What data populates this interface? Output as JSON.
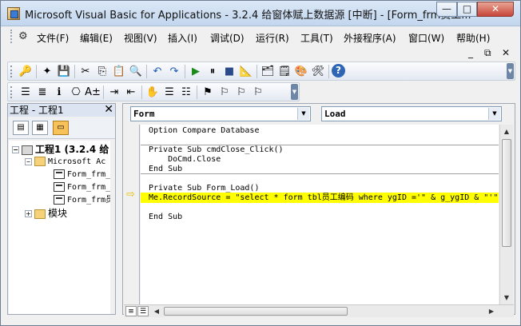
{
  "window": {
    "title": "Microsoft Visual Basic for Applications - 3.2.4 给窗体赋上数据源 [中断] - [Form_frm员工...",
    "controls": {
      "minimize": "—",
      "maximize": "□",
      "close": "✕"
    }
  },
  "menubar": {
    "items": [
      "文件(F)",
      "编辑(E)",
      "视图(V)",
      "插入(I)",
      "调试(D)",
      "运行(R)",
      "工具(T)",
      "外接程序(A)",
      "窗口(W)",
      "帮助(H)"
    ],
    "mdi_controls": {
      "minimize": "_",
      "restore": "⧉",
      "close": "✕"
    }
  },
  "toolbars": {
    "standard": [
      {
        "name": "access-view-icon",
        "glyph": "🔑"
      },
      {
        "name": "insert-module-icon",
        "glyph": "✦"
      },
      {
        "name": "save-icon",
        "glyph": "💾"
      },
      {
        "name": "cut-icon",
        "glyph": "✂"
      },
      {
        "name": "copy-icon",
        "glyph": "⎘"
      },
      {
        "name": "paste-icon",
        "glyph": "📋"
      },
      {
        "name": "find-icon",
        "glyph": "🔍"
      },
      {
        "name": "undo-icon",
        "glyph": "↶"
      },
      {
        "name": "redo-icon",
        "glyph": "↷"
      },
      {
        "name": "run-icon",
        "glyph": "▶"
      },
      {
        "name": "break-icon",
        "glyph": "⏸"
      },
      {
        "name": "reset-icon",
        "glyph": "■"
      },
      {
        "name": "design-mode-icon",
        "glyph": "📐"
      },
      {
        "name": "project-explorer-icon",
        "glyph": "🗂"
      },
      {
        "name": "properties-icon",
        "glyph": "🗒"
      },
      {
        "name": "object-browser-icon",
        "glyph": "🎨"
      },
      {
        "name": "toolbox-icon",
        "glyph": "🛠"
      },
      {
        "name": "help-icon",
        "glyph": "?"
      }
    ],
    "edit": [
      {
        "name": "list-properties-icon",
        "glyph": "☰"
      },
      {
        "name": "list-constants-icon",
        "glyph": "≣"
      },
      {
        "name": "quick-info-icon",
        "glyph": "ℹ"
      },
      {
        "name": "parameter-info-icon",
        "glyph": "⎔"
      },
      {
        "name": "complete-word-icon",
        "glyph": "A±"
      },
      {
        "name": "indent-icon",
        "glyph": "⇥"
      },
      {
        "name": "outdent-icon",
        "glyph": "⇤"
      },
      {
        "name": "toggle-breakpoint-icon",
        "glyph": "✋"
      },
      {
        "name": "comment-block-icon",
        "glyph": "☰"
      },
      {
        "name": "uncomment-block-icon",
        "glyph": "☷"
      },
      {
        "name": "toggle-bookmark-icon",
        "glyph": "⚑"
      },
      {
        "name": "next-bookmark-icon",
        "glyph": "⚐"
      },
      {
        "name": "previous-bookmark-icon",
        "glyph": "⚐"
      },
      {
        "name": "clear-bookmarks-icon",
        "glyph": "⚐"
      }
    ]
  },
  "project": {
    "title": "工程 - 工程1",
    "close": "✕",
    "tree": {
      "root": "工程1 (3.2.4 给",
      "folder1": "Microsoft Ac",
      "items": [
        "Form_frm_",
        "Form_frm_",
        "Form_frm员"
      ],
      "folder2": "模块"
    }
  },
  "code": {
    "object_combo": "Form",
    "procedure_combo": "Load",
    "lines": [
      "Option Compare Database",
      "",
      "Private Sub cmdClose_Click()",
      "    DoCmd.Close",
      "End Sub",
      "",
      "Private Sub Form_Load()",
      "Me.RecordSource = \"select * form tbl员工编码 where ygID ='\" & g_ygID & \"'\"",
      "",
      "End Sub"
    ]
  },
  "scroll": {
    "up": "▲",
    "down": "▼",
    "left": "◀",
    "right": "▶"
  },
  "colors": {
    "highlight": "#ffff00",
    "exec_arrow": "#e3c100"
  }
}
